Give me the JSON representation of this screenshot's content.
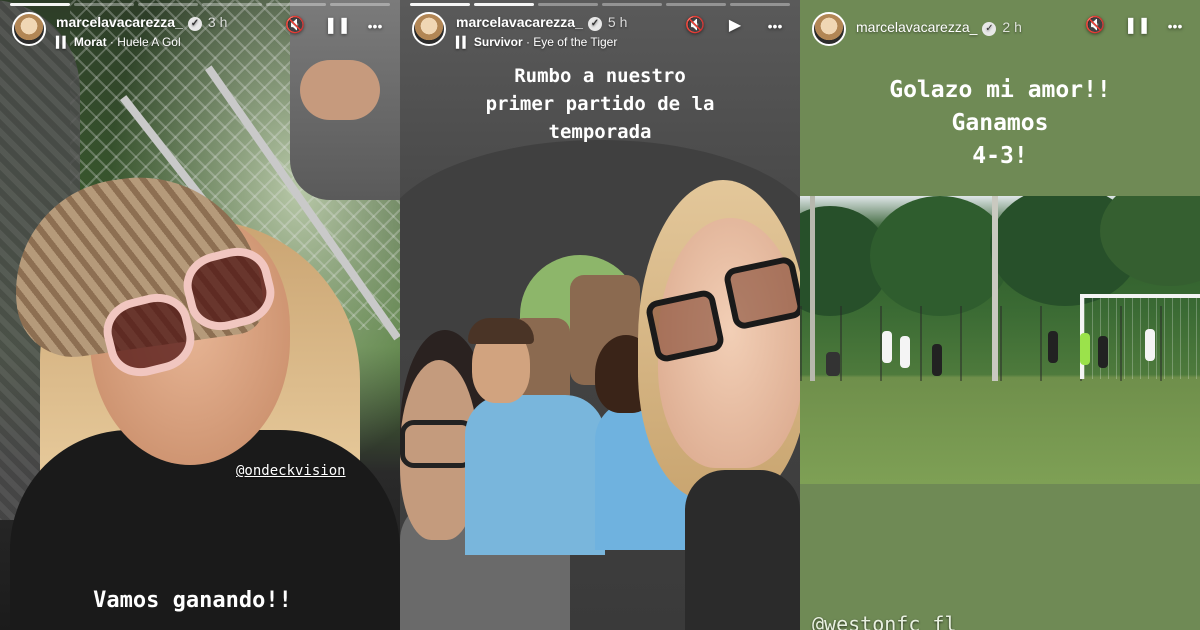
{
  "stories": [
    {
      "username": "marcelavacarezza_",
      "time_ago": "3 h",
      "music_artist": "Morat",
      "music_song": "Huele A Gol",
      "sticker": "@ondeckvision",
      "caption": "Vamos ganando!!",
      "progress": {
        "segments": 6,
        "done": 1
      }
    },
    {
      "username": "marcelavacarezza_",
      "time_ago": "5 h",
      "music_artist": "Survivor",
      "music_song": "Eye of the Tiger",
      "caption": "Rumbo a nuestro\nprimer partido de la\ntemporada",
      "progress": {
        "segments": 6,
        "done": 2
      }
    },
    {
      "username": "marcelavacarezza_",
      "time_ago": "2 h",
      "caption": "Golazo mi amor!!\nGanamos\n4-3!",
      "tag": "@westonfc_fl",
      "progress": {
        "segments": 0,
        "done": 0
      }
    }
  ],
  "icons": {
    "verified": "✓",
    "music": "▍▍",
    "mute": "🔇",
    "pause": "❚❚",
    "play": "▶",
    "more": "•••"
  },
  "colors": {
    "story3_bg": "#6f8a55",
    "shirt_blue": "#79b6dc"
  }
}
